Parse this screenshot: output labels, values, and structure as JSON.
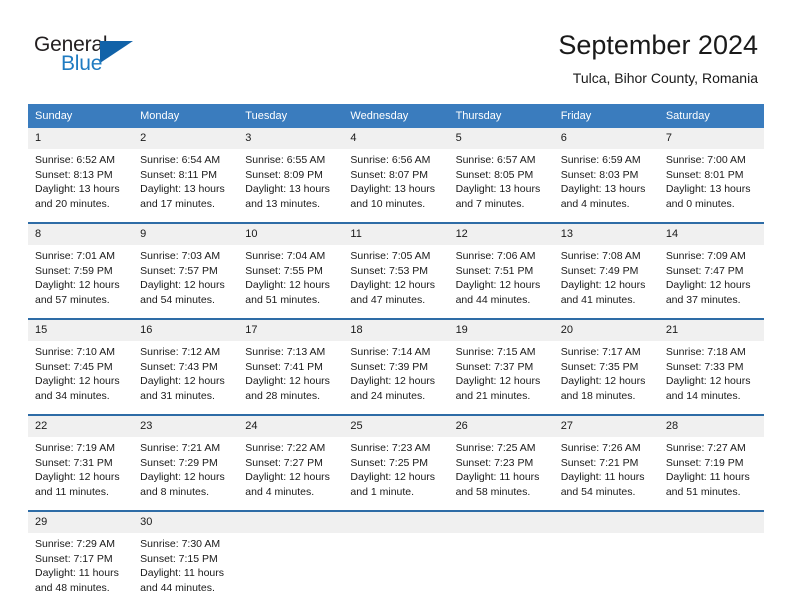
{
  "brand": {
    "word_one": "General",
    "word_two": "Blue",
    "logo_icon": "triangle-icon"
  },
  "header": {
    "title": "September 2024",
    "subtitle": "Tulca, Bihor County, Romania"
  },
  "calendar": {
    "weekday_headers": [
      "Sunday",
      "Monday",
      "Tuesday",
      "Wednesday",
      "Thursday",
      "Friday",
      "Saturday"
    ],
    "colors": {
      "header_blue": "#3a7cbe",
      "separator_blue": "#2e6ca6",
      "daynum_band": "#f0f0f0",
      "brand_blue": "#1f7bc1",
      "brand_triangle": "#1162a8",
      "text": "#1a1a1a"
    },
    "weeks": [
      [
        {
          "day": "1",
          "lines": [
            "Sunrise: 6:52 AM",
            "Sunset: 8:13 PM",
            "Daylight: 13 hours",
            "and 20 minutes."
          ]
        },
        {
          "day": "2",
          "lines": [
            "Sunrise: 6:54 AM",
            "Sunset: 8:11 PM",
            "Daylight: 13 hours",
            "and 17 minutes."
          ]
        },
        {
          "day": "3",
          "lines": [
            "Sunrise: 6:55 AM",
            "Sunset: 8:09 PM",
            "Daylight: 13 hours",
            "and 13 minutes."
          ]
        },
        {
          "day": "4",
          "lines": [
            "Sunrise: 6:56 AM",
            "Sunset: 8:07 PM",
            "Daylight: 13 hours",
            "and 10 minutes."
          ]
        },
        {
          "day": "5",
          "lines": [
            "Sunrise: 6:57 AM",
            "Sunset: 8:05 PM",
            "Daylight: 13 hours",
            "and 7 minutes."
          ]
        },
        {
          "day": "6",
          "lines": [
            "Sunrise: 6:59 AM",
            "Sunset: 8:03 PM",
            "Daylight: 13 hours",
            "and 4 minutes."
          ]
        },
        {
          "day": "7",
          "lines": [
            "Sunrise: 7:00 AM",
            "Sunset: 8:01 PM",
            "Daylight: 13 hours",
            "and 0 minutes."
          ]
        }
      ],
      [
        {
          "day": "8",
          "lines": [
            "Sunrise: 7:01 AM",
            "Sunset: 7:59 PM",
            "Daylight: 12 hours",
            "and 57 minutes."
          ]
        },
        {
          "day": "9",
          "lines": [
            "Sunrise: 7:03 AM",
            "Sunset: 7:57 PM",
            "Daylight: 12 hours",
            "and 54 minutes."
          ]
        },
        {
          "day": "10",
          "lines": [
            "Sunrise: 7:04 AM",
            "Sunset: 7:55 PM",
            "Daylight: 12 hours",
            "and 51 minutes."
          ]
        },
        {
          "day": "11",
          "lines": [
            "Sunrise: 7:05 AM",
            "Sunset: 7:53 PM",
            "Daylight: 12 hours",
            "and 47 minutes."
          ]
        },
        {
          "day": "12",
          "lines": [
            "Sunrise: 7:06 AM",
            "Sunset: 7:51 PM",
            "Daylight: 12 hours",
            "and 44 minutes."
          ]
        },
        {
          "day": "13",
          "lines": [
            "Sunrise: 7:08 AM",
            "Sunset: 7:49 PM",
            "Daylight: 12 hours",
            "and 41 minutes."
          ]
        },
        {
          "day": "14",
          "lines": [
            "Sunrise: 7:09 AM",
            "Sunset: 7:47 PM",
            "Daylight: 12 hours",
            "and 37 minutes."
          ]
        }
      ],
      [
        {
          "day": "15",
          "lines": [
            "Sunrise: 7:10 AM",
            "Sunset: 7:45 PM",
            "Daylight: 12 hours",
            "and 34 minutes."
          ]
        },
        {
          "day": "16",
          "lines": [
            "Sunrise: 7:12 AM",
            "Sunset: 7:43 PM",
            "Daylight: 12 hours",
            "and 31 minutes."
          ]
        },
        {
          "day": "17",
          "lines": [
            "Sunrise: 7:13 AM",
            "Sunset: 7:41 PM",
            "Daylight: 12 hours",
            "and 28 minutes."
          ]
        },
        {
          "day": "18",
          "lines": [
            "Sunrise: 7:14 AM",
            "Sunset: 7:39 PM",
            "Daylight: 12 hours",
            "and 24 minutes."
          ]
        },
        {
          "day": "19",
          "lines": [
            "Sunrise: 7:15 AM",
            "Sunset: 7:37 PM",
            "Daylight: 12 hours",
            "and 21 minutes."
          ]
        },
        {
          "day": "20",
          "lines": [
            "Sunrise: 7:17 AM",
            "Sunset: 7:35 PM",
            "Daylight: 12 hours",
            "and 18 minutes."
          ]
        },
        {
          "day": "21",
          "lines": [
            "Sunrise: 7:18 AM",
            "Sunset: 7:33 PM",
            "Daylight: 12 hours",
            "and 14 minutes."
          ]
        }
      ],
      [
        {
          "day": "22",
          "lines": [
            "Sunrise: 7:19 AM",
            "Sunset: 7:31 PM",
            "Daylight: 12 hours",
            "and 11 minutes."
          ]
        },
        {
          "day": "23",
          "lines": [
            "Sunrise: 7:21 AM",
            "Sunset: 7:29 PM",
            "Daylight: 12 hours",
            "and 8 minutes."
          ]
        },
        {
          "day": "24",
          "lines": [
            "Sunrise: 7:22 AM",
            "Sunset: 7:27 PM",
            "Daylight: 12 hours",
            "and 4 minutes."
          ]
        },
        {
          "day": "25",
          "lines": [
            "Sunrise: 7:23 AM",
            "Sunset: 7:25 PM",
            "Daylight: 12 hours",
            "and 1 minute."
          ]
        },
        {
          "day": "26",
          "lines": [
            "Sunrise: 7:25 AM",
            "Sunset: 7:23 PM",
            "Daylight: 11 hours",
            "and 58 minutes."
          ]
        },
        {
          "day": "27",
          "lines": [
            "Sunrise: 7:26 AM",
            "Sunset: 7:21 PM",
            "Daylight: 11 hours",
            "and 54 minutes."
          ]
        },
        {
          "day": "28",
          "lines": [
            "Sunrise: 7:27 AM",
            "Sunset: 7:19 PM",
            "Daylight: 11 hours",
            "and 51 minutes."
          ]
        }
      ],
      [
        {
          "day": "29",
          "lines": [
            "Sunrise: 7:29 AM",
            "Sunset: 7:17 PM",
            "Daylight: 11 hours",
            "and 48 minutes."
          ]
        },
        {
          "day": "30",
          "lines": [
            "Sunrise: 7:30 AM",
            "Sunset: 7:15 PM",
            "Daylight: 11 hours",
            "and 44 minutes."
          ]
        },
        {
          "day": "",
          "lines": []
        },
        {
          "day": "",
          "lines": []
        },
        {
          "day": "",
          "lines": []
        },
        {
          "day": "",
          "lines": []
        },
        {
          "day": "",
          "lines": []
        }
      ]
    ]
  }
}
